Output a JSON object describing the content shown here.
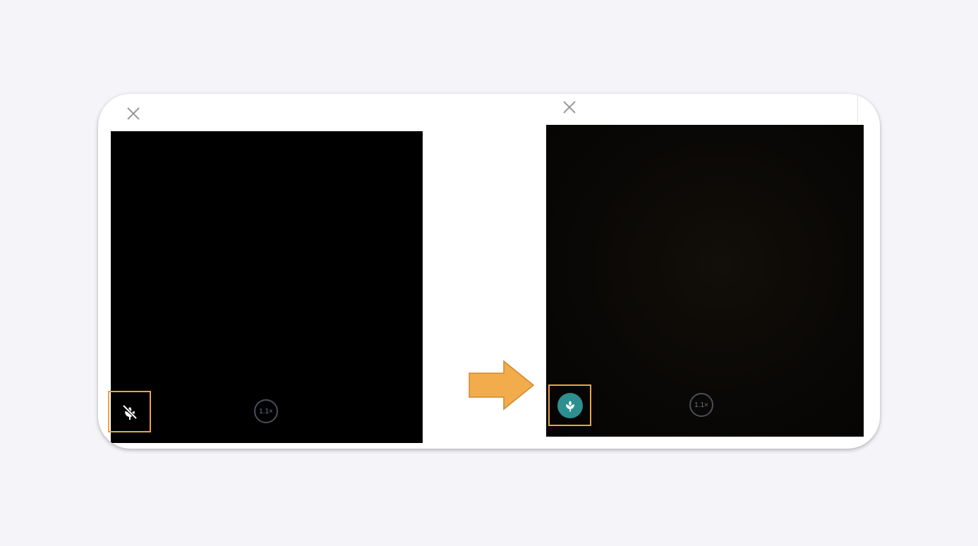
{
  "before_panel": {
    "close_icon": "close-icon",
    "macro_icon": "macro-off-icon",
    "zoom_label": "1.1×"
  },
  "after_panel": {
    "close_icon": "close-icon",
    "macro_icon": "macro-on-icon",
    "zoom_label": "1.1×"
  },
  "transition_arrow": "arrow-right-icon",
  "colors": {
    "page_background": "#f4f4f9",
    "card_background": "#ffffff",
    "highlight_box": "#e9a347",
    "arrow_fill": "#f2ac4c",
    "macro_active": "#2e8f91",
    "viewfinder": "#000000"
  }
}
